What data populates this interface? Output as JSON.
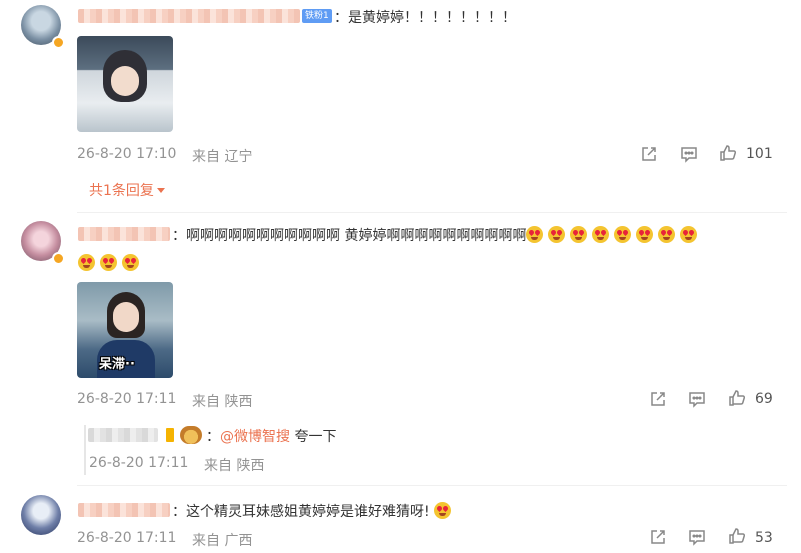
{
  "comments": [
    {
      "fan_badge": "铁粉1",
      "text": "：是黄婷婷！！！！！！！！",
      "time": "26-8-20 17:10",
      "location": "来自 辽宁",
      "like_count": "101",
      "reply_toggle": "共1条回复"
    },
    {
      "text_prefix": "：啊啊啊啊啊啊啊啊啊啊啊 黄婷婷啊啊啊啊啊啊啊啊啊啊",
      "image_caption": "呆滞··",
      "time": "26-8-20 17:11",
      "location": "来自 陕西",
      "like_count": "69",
      "reply": {
        "mention": "@微博智搜",
        "text": "夸一下",
        "time": "26-8-20 17:11",
        "location": "来自 陕西"
      }
    },
    {
      "text": "：这个精灵耳妹感姐黄婷婷是谁好难猜呀!",
      "time": "26-8-20 17:11",
      "location": "来自 广西",
      "like_count": "53"
    }
  ],
  "colors": {
    "accent": "#eb7350",
    "meta": "#939393",
    "fan_badge": "#5f9cf4"
  }
}
